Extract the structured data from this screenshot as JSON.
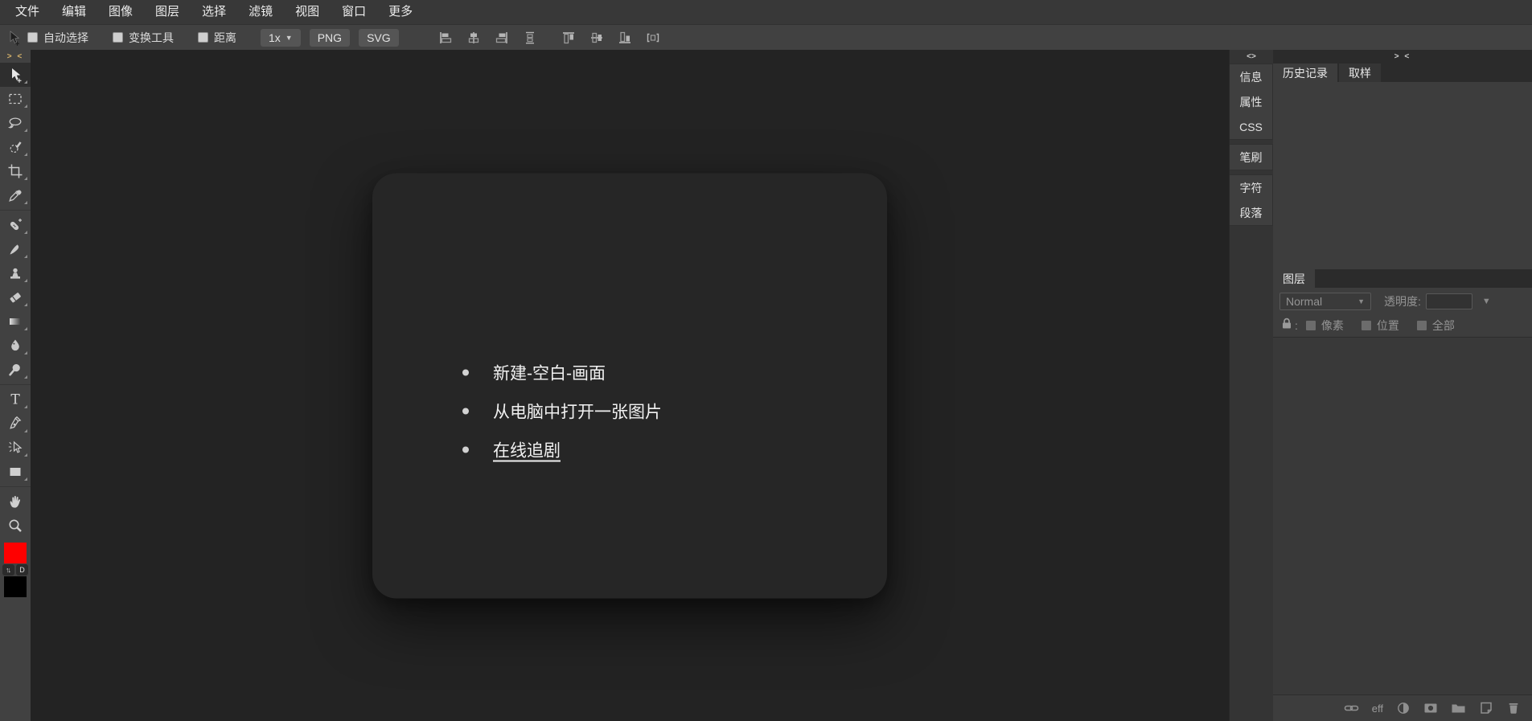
{
  "menu_bar": {
    "items": [
      "文件",
      "编辑",
      "图像",
      "图层",
      "选择",
      "滤镜",
      "视图",
      "窗口",
      "更多"
    ]
  },
  "options_bar": {
    "tool_icon": "move-cursor-icon",
    "checkboxes": [
      {
        "label": "自动选择",
        "checked": false
      },
      {
        "label": "变换工具",
        "checked": false
      },
      {
        "label": "距离",
        "checked": false
      }
    ],
    "zoom_level": "1x",
    "export_buttons": [
      "PNG",
      "SVG"
    ],
    "align_icons": [
      "align-left",
      "align-center-horizontal",
      "align-right",
      "distribute-vertical",
      "align-top",
      "align-middle-vertical",
      "align-bottom",
      "distribute-horizontal"
    ]
  },
  "left_toolbar": {
    "collapse": "> <",
    "selected_tool": "move",
    "tools": [
      "move",
      "rectangle-select",
      "lasso",
      "quick-select",
      "crop",
      "eyedropper",
      "spot-healing",
      "brush",
      "clone-stamp",
      "eraser",
      "gradient",
      "blur",
      "dodge",
      "type",
      "pen",
      "direct-select",
      "rectangle-shape",
      "hand",
      "zoom"
    ],
    "foreground_color": "#ff0000",
    "background_color": "#000000",
    "default_colors_label": "D"
  },
  "canvas_card": {
    "bullets": [
      {
        "text": "新建-空白-画面",
        "underline": false
      },
      {
        "text": "从电脑中打开一张图片",
        "underline": false
      },
      {
        "text": "在线追剧",
        "underline": true
      }
    ]
  },
  "right_strip": {
    "collapse": "<>",
    "groups": [
      [
        "信息",
        "属性",
        "CSS"
      ],
      [
        "笔刷"
      ],
      [
        "字符",
        "段落"
      ]
    ]
  },
  "right_panel": {
    "collapse": "> <",
    "tabs": [
      {
        "label": "历史记录",
        "active": true
      },
      {
        "label": "取样",
        "active": false
      }
    ],
    "layers": {
      "tab_label": "图层",
      "blend_mode": "Normal",
      "opacity_label": "透明度:",
      "opacity_value": "",
      "lock_items": [
        "像素",
        "位置",
        "全部"
      ],
      "eff_label": "eff",
      "bottom_icons": [
        "link",
        "eff",
        "adjustment",
        "mask",
        "folder",
        "new-layer",
        "trash"
      ]
    }
  }
}
